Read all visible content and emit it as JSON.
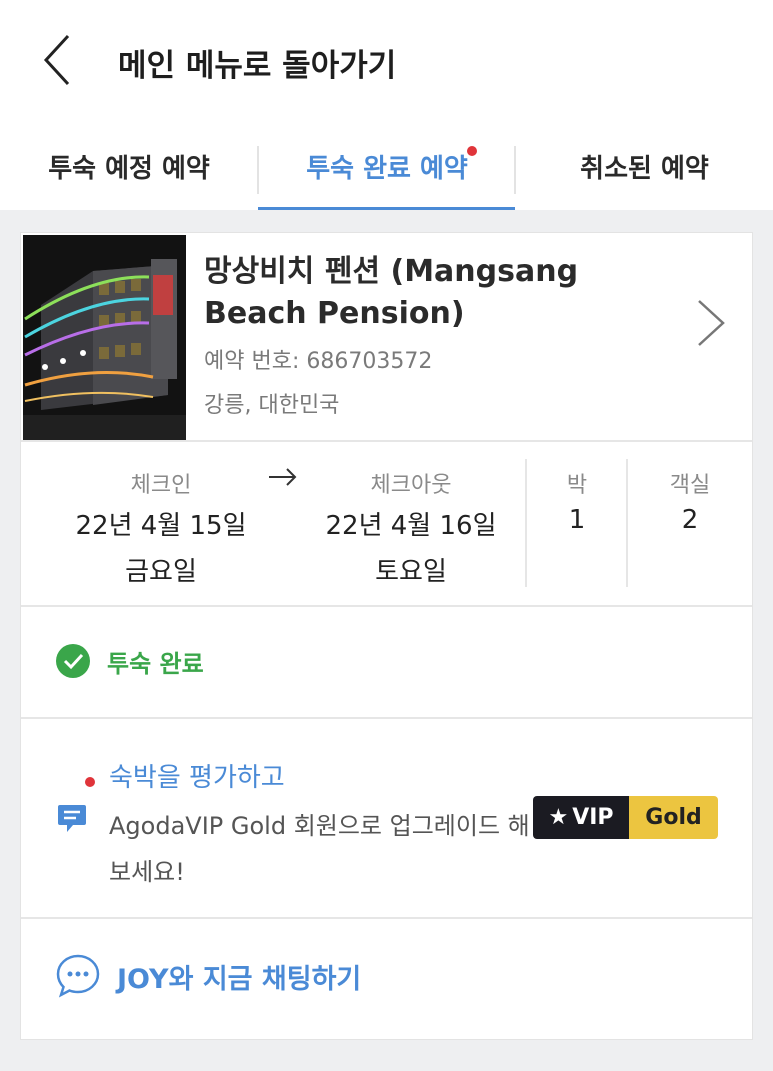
{
  "header": {
    "title": "메인 메뉴로 돌아가기"
  },
  "tabs": [
    {
      "label": "투숙 예정 예약"
    },
    {
      "label": "투숙 완료 예약"
    },
    {
      "label": "취소된 예약"
    }
  ],
  "booking": {
    "hotel_name": "망상비치 펜션 (Mangsang Beach Pension)",
    "booking_number": "예약 번호: 686703572",
    "location": "강릉, 대한민국",
    "checkin_label": "체크인",
    "checkin_date": "22년 4월 15일",
    "checkin_day": "금요일",
    "checkout_label": "체크아웃",
    "checkout_date": "22년 4월 16일",
    "checkout_day": "토요일",
    "nights_label": "박",
    "nights": "1",
    "rooms_label": "객실",
    "rooms": "2",
    "status": "투숙 완료"
  },
  "review": {
    "link": "숙박을 평가하고",
    "description": "AgodaVIP Gold 회원으로 업그레이드 해 보세요!",
    "vip_label": "VIP",
    "gold_label": "Gold"
  },
  "chat": {
    "label": "JOY와 지금 채팅하기"
  },
  "colors": {
    "accent": "#4a8ad6",
    "success": "#3aa64a",
    "alert": "#e0343a",
    "vip_dark": "#1b1b22",
    "gold": "#ecc540"
  }
}
